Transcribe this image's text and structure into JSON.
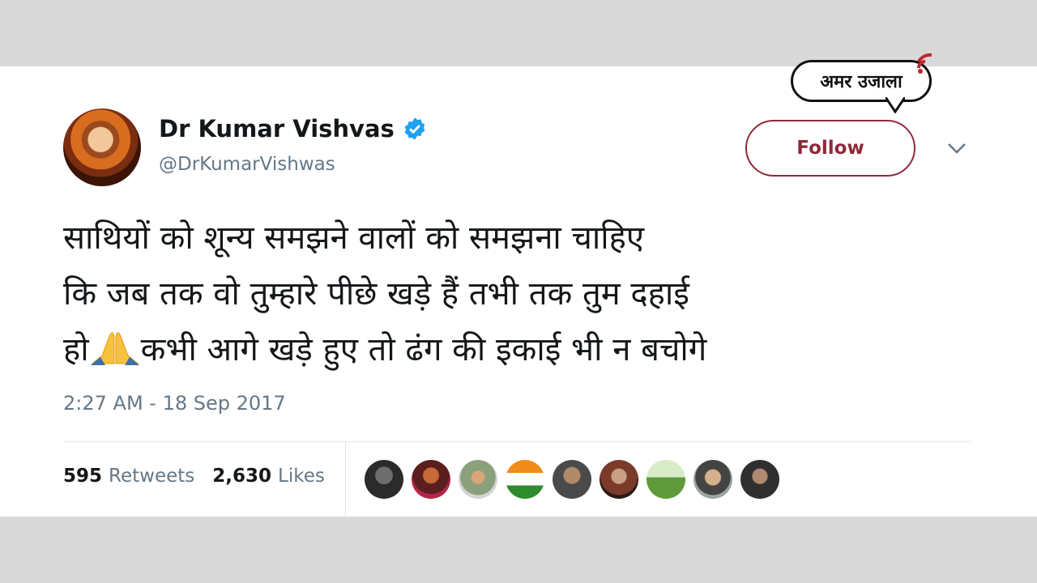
{
  "brand": {
    "logo_text": "अमर उजाला",
    "accent": "#c0272d"
  },
  "tweet": {
    "display_name": "Dr Kumar Vishvas",
    "handle": "@DrKumarVishwas",
    "verified_icon": "verified-badge-icon",
    "follow_label": "Follow",
    "text_line1": "साथियों को शून्य समझने वालों को समझना चाहिए",
    "text_line2": "कि जब तक वो तुम्हारे पीछे खड़े हैं तभी तक तुम दहाई",
    "text_line3_a": "हो",
    "text_line3_b": "कभी आगे खड़े हुए तो ढंग की इकाई भी न बचोगे",
    "emoji": "folded-hands-icon",
    "timestamp": "2:27 AM - 18 Sep 2017",
    "retweets_count": "595",
    "retweets_label": "Retweets",
    "likes_count": "2,630",
    "likes_label": "Likes"
  },
  "colors": {
    "follow_border": "#8d2a3a",
    "verified": "#1da1f2",
    "secondary_text": "#657786"
  }
}
